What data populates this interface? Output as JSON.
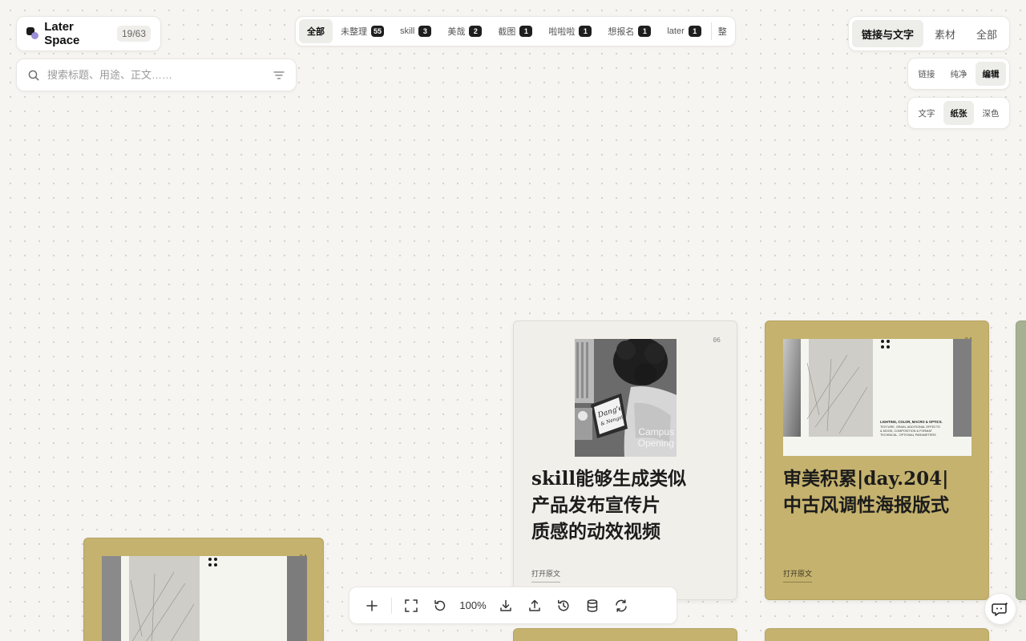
{
  "brand": {
    "name": "Later Space",
    "count": "19/63"
  },
  "search": {
    "placeholder": "搜索标题、用途、正文……"
  },
  "tags": [
    {
      "label": "全部",
      "count": null,
      "active": true
    },
    {
      "label": "未整理",
      "count": "55",
      "active": false
    },
    {
      "label": "skill",
      "count": "3",
      "active": false
    },
    {
      "label": "美哉",
      "count": "2",
      "active": false
    },
    {
      "label": "截图",
      "count": "1",
      "active": false
    },
    {
      "label": "啦啦啦",
      "count": "1",
      "active": false
    },
    {
      "label": "想报名",
      "count": "1",
      "active": false
    },
    {
      "label": "later",
      "count": "1",
      "active": false
    }
  ],
  "tags_more": "整",
  "view_mode": {
    "options": [
      "链接与文字",
      "素材",
      "全部"
    ],
    "active": "链接与文字"
  },
  "card_mode": {
    "options": [
      "链接",
      "纯净",
      "编辑"
    ],
    "active": "编辑"
  },
  "style_mode": {
    "options": [
      "文字",
      "纸张",
      "深色"
    ],
    "active": "纸张"
  },
  "cards": [
    {
      "number": "06",
      "title": "skill能够生成类似产品发布宣传片质感的动效视频",
      "title_lines": [
        "skill能够生成类似",
        "产品发布宣传片",
        "质感的动效视频"
      ],
      "link": "打开原文",
      "image_text": {
        "handwriting_1": "Dang'e",
        "handwriting_2": "& Nengzi",
        "caption_1": "Campus",
        "caption_2": "Opening"
      },
      "style": "cream"
    },
    {
      "number": "04",
      "title": "审美积累|day.204|中古风调性海报版式",
      "title_lines": [
        "审美积累|day.204|",
        "中古风调性海报版式"
      ],
      "link": "打开原文",
      "image_text": {
        "line_1": "LIGHTING, COLOR, MACRO & OPTICS.",
        "line_2": "TEXTURE, GRAIN, ADDITIONAL EFFECTS",
        "line_3": "& MOOD, COMPOSITION & FORMAT",
        "line_4": "TECHNICAL, OPTIONAL PARAMETERS"
      },
      "style": "gold"
    },
    {
      "number": "04",
      "style": "gold"
    }
  ],
  "toolbar": {
    "zoom": "100%"
  },
  "colors": {
    "card_gold": "#c5b26e",
    "card_cream": "#f1efea",
    "card_green": "#a6b092",
    "badge": "#1e1e1e",
    "accent_purple": "#9b8fd6"
  }
}
